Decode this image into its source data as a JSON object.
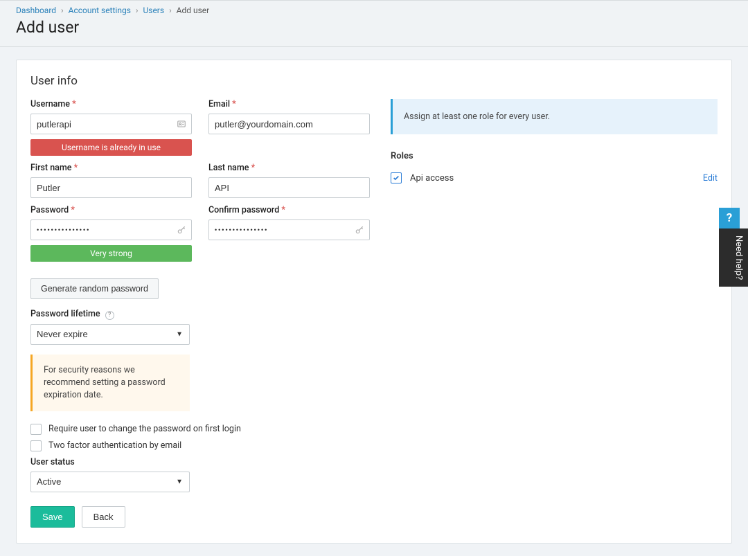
{
  "breadcrumb": {
    "items": [
      "Dashboard",
      "Account settings",
      "Users"
    ],
    "current": "Add user"
  },
  "page_title": "Add user",
  "section_title": "User info",
  "labels": {
    "username": "Username",
    "email": "Email",
    "firstname": "First name",
    "lastname": "Last name",
    "password": "Password",
    "confirm_password": "Confirm password",
    "password_lifetime": "Password lifetime",
    "user_status": "User status",
    "roles": "Roles"
  },
  "values": {
    "username": "putlerapi",
    "email": "putler@yourdomain.com",
    "firstname": "Putler",
    "lastname": "API",
    "password": "•••••••••••••••",
    "confirm_password": "•••••••••••••••",
    "password_lifetime": "Never expire",
    "user_status": "Active"
  },
  "messages": {
    "username_error": "Username is already in use",
    "password_strength": "Very strong",
    "generate_password": "Generate random password",
    "password_lifetime_note": "For security reasons we recommend setting a password expiration date.",
    "role_banner": "Assign at least one role for every user."
  },
  "checkboxes": {
    "require_change": "Require user to change the password on first login",
    "two_factor": "Two factor authentication by email"
  },
  "roles": [
    {
      "name": "Api access",
      "checked": true
    }
  ],
  "buttons": {
    "save": "Save",
    "back": "Back",
    "edit": "Edit"
  },
  "help": {
    "label": "Need help?"
  }
}
